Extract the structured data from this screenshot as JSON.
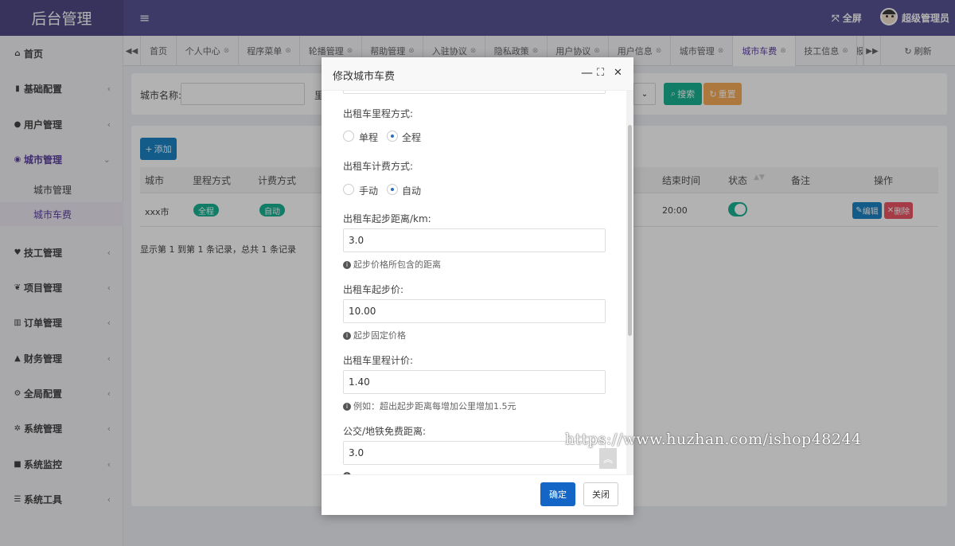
{
  "app": {
    "title": "后台管理",
    "fullscreen": "全屏",
    "username": "超级管理员"
  },
  "sidebar": {
    "items": [
      {
        "icon": "home-icon",
        "glyph": "⌂",
        "label": "首页"
      },
      {
        "icon": "bookmark-icon",
        "glyph": "▮",
        "label": "基础配置"
      },
      {
        "icon": "user-icon",
        "glyph": "●",
        "label": "用户管理"
      },
      {
        "icon": "globe-icon",
        "glyph": "◉",
        "label": "城市管理"
      },
      {
        "icon": "heart-icon",
        "glyph": "♥",
        "label": "技工管理"
      },
      {
        "icon": "leaf-icon",
        "glyph": "❦",
        "label": "项目管理"
      },
      {
        "icon": "bar-chart-icon",
        "glyph": "▥",
        "label": "订单管理"
      },
      {
        "icon": "area-chart-icon",
        "glyph": "▲",
        "label": "财务管理"
      },
      {
        "icon": "cogs-icon",
        "glyph": "⚙",
        "label": "全局配置"
      },
      {
        "icon": "gear-icon",
        "glyph": "✲",
        "label": "系统管理"
      },
      {
        "icon": "video-icon",
        "glyph": "■",
        "label": "系统监控"
      },
      {
        "icon": "list-icon",
        "glyph": "☰",
        "label": "系统工具"
      }
    ],
    "sub": [
      {
        "label": "城市管理"
      },
      {
        "label": "城市车费"
      }
    ]
  },
  "tabs": [
    "首页",
    "个人中心",
    "程序菜单",
    "轮播管理",
    "帮助管理",
    "入驻协议",
    "隐私政策",
    "用户协议",
    "用户信息",
    "城市管理",
    "城市车费",
    "技工信息",
    "求救报警"
  ],
  "tab_refresh": "刷新",
  "search": {
    "city_label": "城市名称:",
    "partial_label": "里",
    "search_btn": "搜索",
    "reset_btn": "重置"
  },
  "table": {
    "add_btn": "添加",
    "headers": [
      "城市",
      "里程方式",
      "计费方式",
      "结束时间",
      "状态",
      "备注",
      "操作"
    ],
    "row": {
      "city": "xxx市",
      "mileage": "全程",
      "billing": "自动",
      "end_time": "20:00",
      "status_on": true,
      "edit": "编辑",
      "delete": "删除"
    },
    "footer": "显示第 1 到第 1 条记录，总共 1 条记录"
  },
  "modal": {
    "title": "修改城市车费",
    "mileage_label": "出租车里程方式:",
    "mileage_opts": [
      "单程",
      "全程"
    ],
    "billing_label": "出租车计费方式:",
    "billing_opts": [
      "手动",
      "自动"
    ],
    "start_dist_label": "出租车起步距离/km:",
    "start_dist": "3.0",
    "start_dist_help": "起步价格所包含的距离",
    "start_price_label": "出租车起步价:",
    "start_price": "10.00",
    "start_price_help": "起步固定价格",
    "per_km_label": "出租车里程计价:",
    "per_km": "1.40",
    "per_km_help": "例如：超出起步距离每增加公里增加1.5元",
    "free_dist_label": "公交/地铁免费距离:",
    "free_dist": "3.0",
    "confirm": "确定",
    "close": "关闭"
  },
  "watermark": "https://www.huzhan.com/ishop48244",
  "colors": {
    "topbar": "#595396",
    "primary": "#1c84c6",
    "success": "#1ab394",
    "warning": "#f8ac59",
    "danger": "#ed5565",
    "confirm": "#1366c6"
  }
}
